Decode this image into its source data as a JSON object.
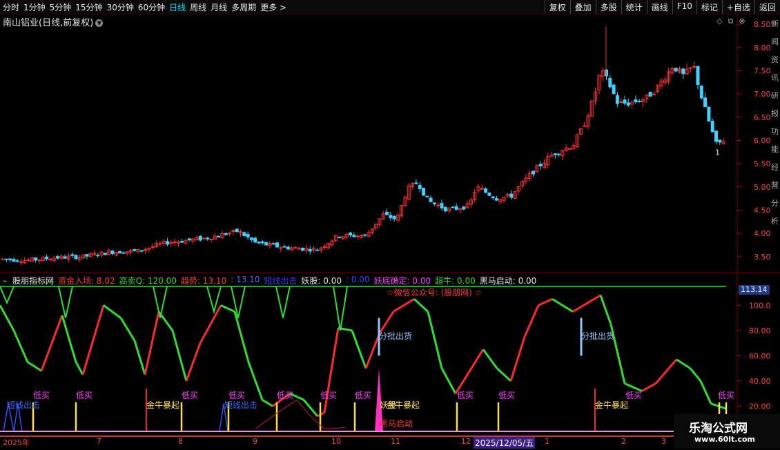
{
  "toolbar": {
    "periods": [
      "分时",
      "1分钟",
      "5分钟",
      "15分钟",
      "30分钟",
      "60分钟",
      "日线",
      "周线",
      "月线",
      "多周期",
      "更多 >"
    ],
    "active_period": "日线",
    "actions": [
      "复权",
      "叠加",
      "多股",
      "统计",
      "画线",
      "F10",
      "标记",
      "+自选",
      "返回"
    ]
  },
  "main": {
    "title": "南山铝业(日线,前复权)",
    "price_axis": [
      "8.50",
      "8.00",
      "7.50",
      "7.00",
      "6.50",
      "6.00",
      "5.50",
      "5.00",
      "4.50",
      "4.00",
      "3.50"
    ],
    "price_range": [
      3.2,
      8.65
    ],
    "candle_low_label": "1"
  },
  "indicator": {
    "name": "股朋指标网",
    "fields": [
      {
        "text": "资金入场: 8.02",
        "color": "#ff3b3b"
      },
      {
        "text": "高卖Q: 120.00",
        "color": "#3cd83c"
      },
      {
        "text": "趋势: 13.10",
        "color": "#ff3b3b"
      },
      {
        "text": ": 13.10",
        "color": "#3b6bff"
      },
      {
        "text": "短线出击",
        "color": "#3b3bff"
      },
      {
        "text": "妖股: 0.00",
        "color": "#e6e6e6"
      },
      {
        "text": ": 0.00",
        "color": "#3b3bff"
      },
      {
        "text": "妖底确定: 0.00",
        "color": "#ff3bff"
      },
      {
        "text": "超牛: 0.00",
        "color": "#3cd83c"
      },
      {
        "text": "黑马启动: 0.00",
        "color": "#e6e6e6"
      }
    ],
    "axis": [
      "100.0",
      "80.00",
      "60.00",
      "40.00",
      "20.00"
    ],
    "current_value": "113.14",
    "wechat_note": "☆微信公众号: (股朋网) ☆",
    "annotations": [
      {
        "text": "低买",
        "color": "#ff3bff"
      },
      {
        "text": "短线出击",
        "color": "#3b6bff"
      },
      {
        "text": "金牛暴起",
        "color": "#ffe040"
      },
      {
        "text": "分批出货",
        "color": "#8ec8ff"
      },
      {
        "text": "黑马启动",
        "color": "#ff3b3b"
      },
      {
        "text": "妖股",
        "color": "#ffe040"
      }
    ]
  },
  "timeline": {
    "labels": [
      "2025年",
      "7",
      "8",
      "9",
      "10",
      "11",
      "12",
      "1",
      "2",
      "3"
    ],
    "highlight": "2025/12/05/五"
  },
  "watermark": {
    "title": "乐淘公式网",
    "url": "www.60lt.com"
  },
  "right_strip_text": "新闻资讯研报功能经营分析"
}
